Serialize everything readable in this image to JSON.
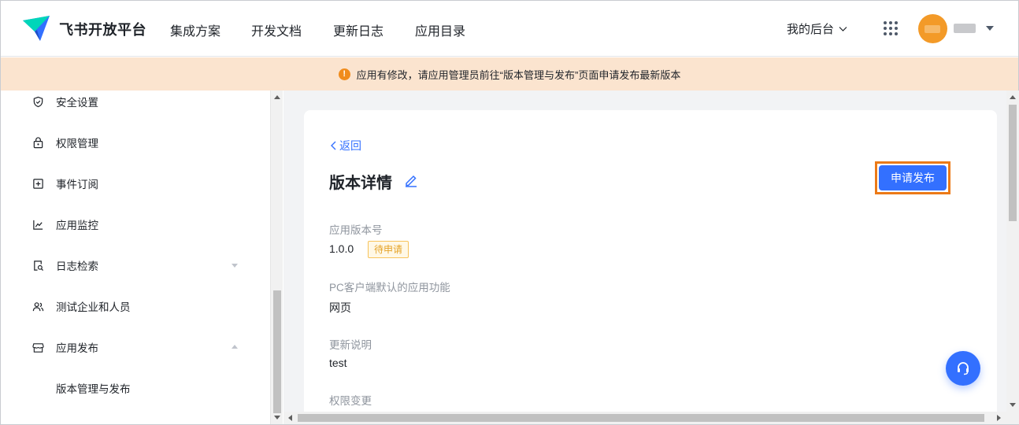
{
  "header": {
    "brand": "飞书开放平台",
    "nav": [
      "集成方案",
      "开发文档",
      "更新日志",
      "应用目录"
    ],
    "backend_label": "我的后台",
    "colors": {
      "brand_blue": "#3370ff",
      "avatar": "#f39a28"
    }
  },
  "notice": {
    "text": "应用有修改，请应用管理员前往“版本管理与发布”页面申请发布最新版本",
    "icon": "warning-icon",
    "bg": "#fbe4cf"
  },
  "sidebar": {
    "items": [
      {
        "label": "安全设置",
        "icon": "shield-icon"
      },
      {
        "label": "权限管理",
        "icon": "lock-icon"
      },
      {
        "label": "事件订阅",
        "icon": "add-box-icon"
      },
      {
        "label": "应用监控",
        "icon": "line-chart-icon"
      },
      {
        "label": "日志检索",
        "icon": "log-search-icon",
        "expanded": false
      },
      {
        "label": "测试企业和人员",
        "icon": "users-icon"
      },
      {
        "label": "应用发布",
        "icon": "store-icon",
        "expanded": true
      },
      {
        "label": "版本管理与发布",
        "sub": true
      }
    ]
  },
  "main": {
    "back_label": "返回",
    "title": "版本详情",
    "publish_label": "申请发布",
    "fields": {
      "version_label": "应用版本号",
      "version_value": "1.0.0",
      "status_tag": "待申请",
      "pc_feature_label": "PC客户端默认的应用功能",
      "pc_feature_value": "网页",
      "update_label": "更新说明",
      "update_value": "test",
      "permission_label": "权限变更"
    }
  }
}
